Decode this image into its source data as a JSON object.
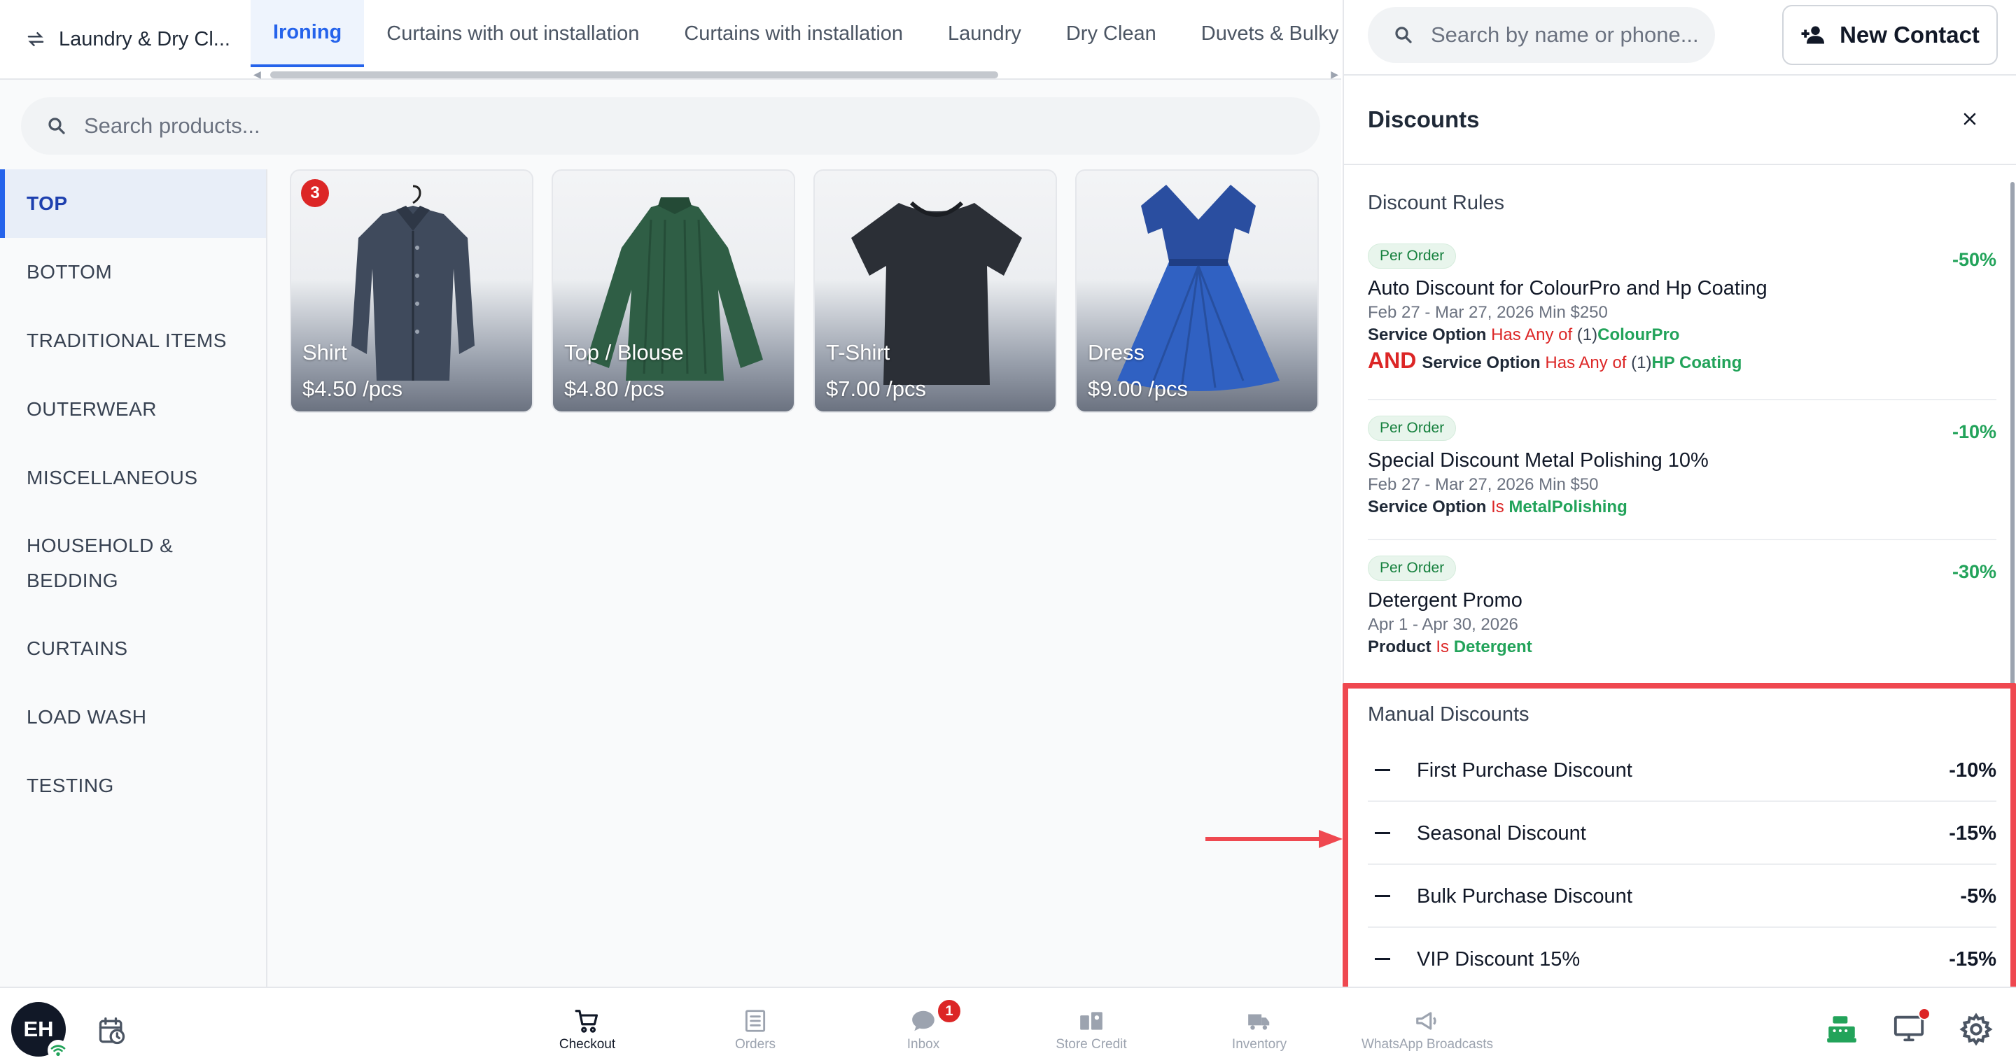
{
  "store": {
    "name": "Laundry & Dry Cl..."
  },
  "tabs": [
    {
      "label": "Ironing",
      "active": true
    },
    {
      "label": "Curtains with out installation",
      "active": false
    },
    {
      "label": "Curtains with installation",
      "active": false
    },
    {
      "label": "Laundry",
      "active": false
    },
    {
      "label": "Dry Clean",
      "active": false
    },
    {
      "label": "Duvets & Bulky Item",
      "active": false
    }
  ],
  "product_search": {
    "placeholder": "Search products..."
  },
  "categories": [
    {
      "label": "TOP",
      "active": true
    },
    {
      "label": "BOTTOM"
    },
    {
      "label": "TRADITIONAL ITEMS"
    },
    {
      "label": "OUTERWEAR"
    },
    {
      "label": "MISCELLANEOUS"
    },
    {
      "label": "HOUSEHOLD & BEDDING"
    },
    {
      "label": "CURTAINS"
    },
    {
      "label": "LOAD WASH"
    },
    {
      "label": "TESTING"
    }
  ],
  "products": [
    {
      "name": "Shirt",
      "price": "$4.50 /pcs",
      "qty": "3",
      "icon": "shirt-image"
    },
    {
      "name": "Top / Blouse",
      "price": "$4.80 /pcs",
      "icon": "blouse-image"
    },
    {
      "name": "T-Shirt",
      "price": "$7.00 /pcs",
      "icon": "tshirt-image"
    },
    {
      "name": "Dress",
      "price": "$9.00 /pcs",
      "icon": "dress-image"
    }
  ],
  "contact_search": {
    "placeholder": "Search by name or phone..."
  },
  "new_contact": {
    "label": "New Contact"
  },
  "discounts": {
    "title": "Discounts",
    "rules_heading": "Discount Rules",
    "rules": [
      {
        "badge": "Per Order",
        "pct": "-50%",
        "title": "Auto Discount for ColourPro and Hp Coating",
        "dates": "Feb 27 - Mar 27, 2026 Min $250",
        "cond1": {
          "key": "Service Option",
          "op": "Has Any of",
          "count": "(1)",
          "value": "ColourPro"
        },
        "cond2": {
          "join": "AND",
          "key": "Service Option",
          "op": "Has Any of",
          "count": "(1)",
          "value": "HP Coating"
        }
      },
      {
        "badge": "Per Order",
        "pct": "-10%",
        "title": "Special Discount Metal Polishing 10%",
        "dates": "Feb 27 - Mar 27, 2026 Min $50",
        "cond1": {
          "key": "Service Option",
          "op": "Is",
          "value": "MetalPolishing"
        }
      },
      {
        "badge": "Per Order",
        "pct": "-30%",
        "title": "Detergent Promo",
        "dates": "Apr 1 - Apr 30, 2026",
        "cond1": {
          "key": "Product",
          "op": "Is",
          "value": "Detergent"
        }
      }
    ],
    "manual_heading": "Manual Discounts",
    "manual": [
      {
        "name": "First Purchase Discount",
        "pct": "-10%"
      },
      {
        "name": "Seasonal Discount",
        "pct": "-15%"
      },
      {
        "name": "Bulk Purchase Discount",
        "pct": "-5%"
      },
      {
        "name": "VIP Discount 15%",
        "pct": "-15%"
      }
    ]
  },
  "user": {
    "initials": "EH"
  },
  "bottom_nav": [
    {
      "label": "Checkout",
      "icon": "cart-icon",
      "active": true
    },
    {
      "label": "Orders",
      "icon": "orders-icon"
    },
    {
      "label": "Inbox",
      "icon": "chat-icon",
      "badge": "1"
    },
    {
      "label": "Store Credit",
      "icon": "wallet-icon"
    },
    {
      "label": "Inventory",
      "icon": "truck-icon"
    },
    {
      "label": "WhatsApp Broadcasts",
      "icon": "megaphone-icon"
    }
  ],
  "colors": {
    "accent": "#2563eb",
    "success": "#22a35a",
    "danger": "#dc2626",
    "highlight": "#ef4850"
  }
}
